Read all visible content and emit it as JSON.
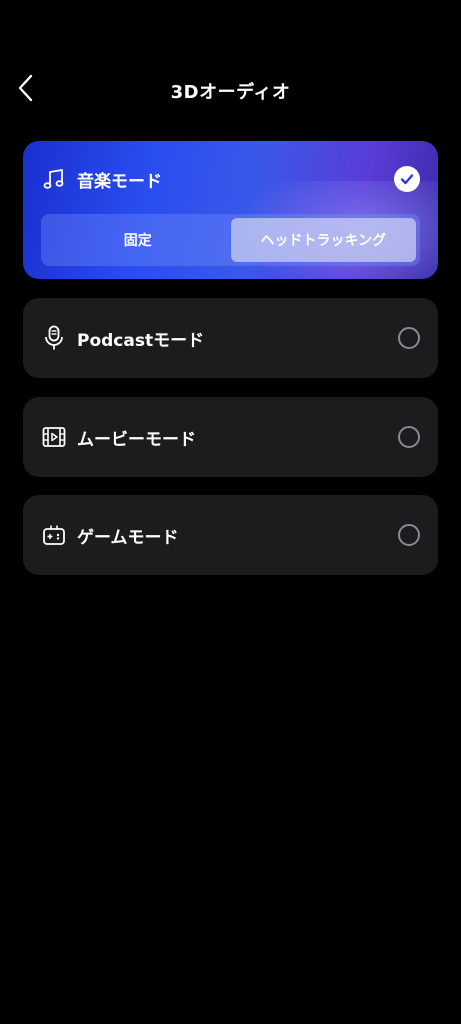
{
  "header": {
    "title": "3Dオーディオ",
    "back_icon": "chevron-left-icon"
  },
  "modes": [
    {
      "id": "music",
      "label": "音楽モード",
      "icon": "music-note-icon",
      "selected": true,
      "segments": [
        {
          "label": "固定",
          "active": false
        },
        {
          "label": "ヘッドトラッキング",
          "active": true
        }
      ]
    },
    {
      "id": "podcast",
      "label": "Podcastモード",
      "icon": "microphone-icon",
      "selected": false
    },
    {
      "id": "movie",
      "label": "ムービーモード",
      "icon": "film-icon",
      "selected": false
    },
    {
      "id": "game",
      "label": "ゲームモード",
      "icon": "gamepad-icon",
      "selected": false
    }
  ],
  "colors": {
    "background": "#000000",
    "card": "#1c1c1e",
    "accent_gradient_start": "#1a2fd0",
    "accent_gradient_end": "#5a3cd8"
  }
}
